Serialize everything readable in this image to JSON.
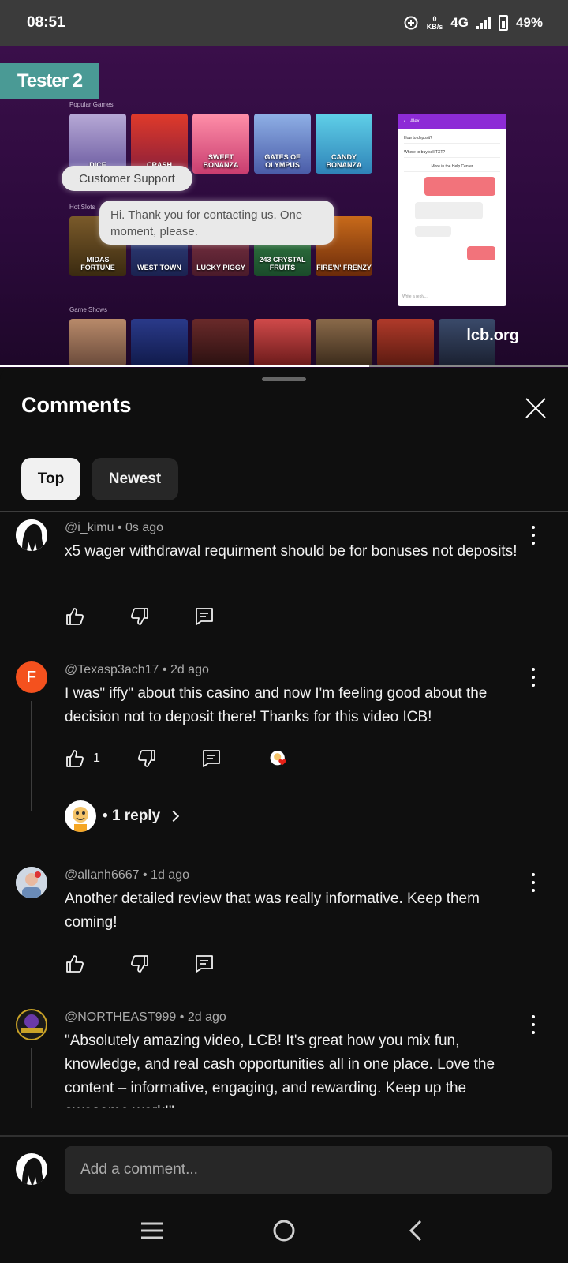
{
  "status_bar": {
    "time": "08:51",
    "kbs_value": "0",
    "kbs_unit": "KB/s",
    "network": "4G",
    "battery": "49%"
  },
  "video": {
    "tester_tag": "Tester 2",
    "section_popular": "Popular Games",
    "section_hot": "Hot Slots",
    "section_shows": "Game Shows",
    "popular_tiles": [
      "DICE",
      "CRASH",
      "SWEET BONANZA",
      "GATES OF OLYMPUS",
      "CANDY BONANZA"
    ],
    "hot_tiles": [
      "MIDAS FORTUNE",
      "WEST TOWN",
      "LUCKY PIGGY",
      "243 CRYSTAL FRUITS",
      "FIRE'N' FRENZY"
    ],
    "bubble_support": "Customer Support",
    "bubble_message": "Hi. Thank you for contacting us. One moment, please.",
    "chat_agent": "Alex",
    "chat_row_1": "How to deposit?",
    "chat_row_2": "Where to buy/sell TXT?",
    "chat_row_3": "More in the Help Center",
    "chat_input_placeholder": "Write a reply...",
    "watermark": "lcb.org",
    "progress": 0.65
  },
  "comments_sheet": {
    "title": "Comments",
    "filters": [
      {
        "label": "Top",
        "selected": true
      },
      {
        "label": "Newest",
        "selected": false
      }
    ],
    "comments": [
      {
        "author": "@i_kimu",
        "time": "0s ago",
        "text": "x5 wager withdrawal requirment should be for bonuses not deposits!",
        "likes": "",
        "avatar": "hooded-figure"
      },
      {
        "author": "@Texasp3ach17",
        "time": "2d ago",
        "text": "I was\" iffy\" about this casino and now I'm feeling good about the decision not to deposit there! Thanks for this video ICB!",
        "likes": "1",
        "avatar_letter": "F",
        "avatar_color": "#f4511e",
        "replies_label": "1 reply"
      },
      {
        "author": "@allanh6667",
        "time": "1d ago",
        "text": "Another detailed review that was really informative. Keep them coming!",
        "likes": "",
        "avatar": "photo"
      },
      {
        "author": "@NORTHEAST999",
        "time": "2d ago",
        "text": "\"Absolutely amazing video, LCB! It's great how you mix fun, knowledge, and real cash opportunities all in one place. Love the content – informative, engaging, and rewarding. Keep up the awesome work!\"",
        "likes": "",
        "avatar": "logo"
      }
    ],
    "compose_placeholder": "Add a comment..."
  },
  "colors": {
    "background": "#0f0f0f",
    "chip_selected": "#f1f1f1",
    "chip_unselected": "#272727",
    "heart": "#e62117"
  }
}
